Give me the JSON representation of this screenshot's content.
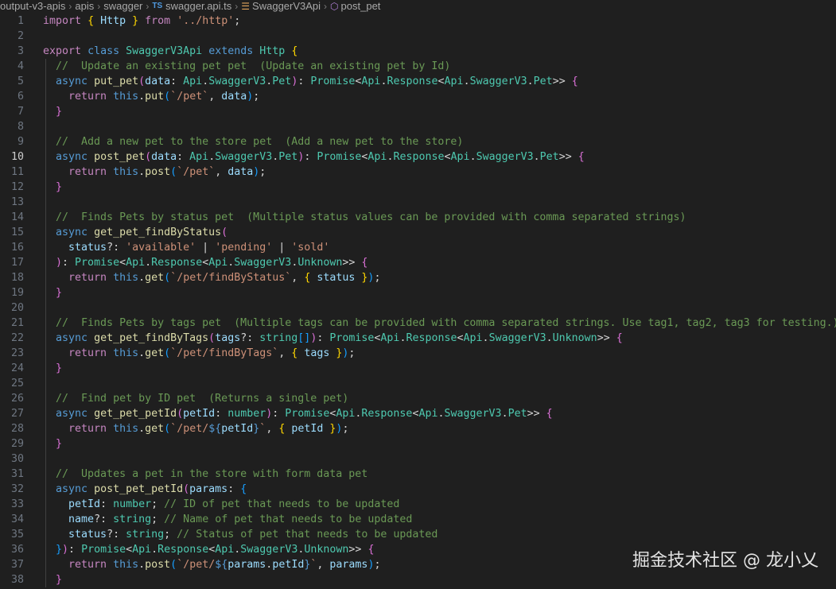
{
  "breadcrumb": {
    "segments": [
      "output-v3-apis",
      "apis",
      "swagger"
    ],
    "file_badge": "TS",
    "file": "swagger.api.ts",
    "class_name": "SwaggerV3Api",
    "method_name": "post_pet",
    "separator": "›"
  },
  "editor": {
    "active_line": 10,
    "colors": {
      "keyword": "#569cd6",
      "control": "#c586c0",
      "function": "#dcdcaa",
      "type": "#4ec9b0",
      "variable": "#9cdcfe",
      "string": "#ce9178",
      "comment": "#6a9955",
      "punctuation": "#d4d4d4",
      "brace_gold": "#ffd700",
      "brace_purple": "#da70d6",
      "brace_blue": "#179fff"
    },
    "lines": [
      [
        [
          "import",
          "control"
        ],
        [
          " ",
          "p"
        ],
        [
          "{",
          "brace_gold"
        ],
        [
          " Http ",
          "variable"
        ],
        [
          "}",
          "brace_gold"
        ],
        [
          " ",
          "p"
        ],
        [
          "from",
          "control"
        ],
        [
          " ",
          "p"
        ],
        [
          "'../http'",
          "string"
        ],
        [
          ";",
          "p"
        ]
      ],
      [],
      [
        [
          "export",
          "control"
        ],
        [
          " ",
          "p"
        ],
        [
          "class",
          "keyword"
        ],
        [
          " ",
          "p"
        ],
        [
          "SwaggerV3Api",
          "type"
        ],
        [
          " ",
          "p"
        ],
        [
          "extends",
          "keyword"
        ],
        [
          " ",
          "p"
        ],
        [
          "Http",
          "type"
        ],
        [
          " ",
          "p"
        ],
        [
          "{",
          "brace_gold"
        ]
      ],
      [
        [
          "  ",
          "p"
        ],
        [
          "//  Update an existing pet pet  (Update an existing pet by Id)",
          "comment"
        ]
      ],
      [
        [
          "  ",
          "p"
        ],
        [
          "async",
          "keyword"
        ],
        [
          " ",
          "p"
        ],
        [
          "put_pet",
          "function"
        ],
        [
          "(",
          "brace_purple"
        ],
        [
          "data",
          "variable"
        ],
        [
          ": ",
          "p"
        ],
        [
          "Api",
          "type"
        ],
        [
          ".",
          "p"
        ],
        [
          "SwaggerV3",
          "type"
        ],
        [
          ".",
          "p"
        ],
        [
          "Pet",
          "type"
        ],
        [
          ")",
          "brace_purple"
        ],
        [
          ": ",
          "p"
        ],
        [
          "Promise",
          "type"
        ],
        [
          "<",
          "p"
        ],
        [
          "Api",
          "type"
        ],
        [
          ".",
          "p"
        ],
        [
          "Response",
          "type"
        ],
        [
          "<",
          "p"
        ],
        [
          "Api",
          "type"
        ],
        [
          ".",
          "p"
        ],
        [
          "SwaggerV3",
          "type"
        ],
        [
          ".",
          "p"
        ],
        [
          "Pet",
          "type"
        ],
        [
          ">> ",
          "p"
        ],
        [
          "{",
          "brace_purple"
        ]
      ],
      [
        [
          "    ",
          "p"
        ],
        [
          "return",
          "control"
        ],
        [
          " ",
          "p"
        ],
        [
          "this",
          "keyword"
        ],
        [
          ".",
          "p"
        ],
        [
          "put",
          "function"
        ],
        [
          "(",
          "brace_blue"
        ],
        [
          "`/pet`",
          "string"
        ],
        [
          ", ",
          "p"
        ],
        [
          "data",
          "variable"
        ],
        [
          ")",
          "brace_blue"
        ],
        [
          ";",
          "p"
        ]
      ],
      [
        [
          "  ",
          "p"
        ],
        [
          "}",
          "brace_purple"
        ]
      ],
      [],
      [
        [
          "  ",
          "p"
        ],
        [
          "//  Add a new pet to the store pet  (Add a new pet to the store)",
          "comment"
        ]
      ],
      [
        [
          "  ",
          "p"
        ],
        [
          "async",
          "keyword"
        ],
        [
          " ",
          "p"
        ],
        [
          "post_pet",
          "function"
        ],
        [
          "(",
          "brace_purple"
        ],
        [
          "data",
          "variable"
        ],
        [
          ": ",
          "p"
        ],
        [
          "Api",
          "type"
        ],
        [
          ".",
          "p"
        ],
        [
          "SwaggerV3",
          "type"
        ],
        [
          ".",
          "p"
        ],
        [
          "Pet",
          "type"
        ],
        [
          ")",
          "brace_purple"
        ],
        [
          ": ",
          "p"
        ],
        [
          "Promise",
          "type"
        ],
        [
          "<",
          "p"
        ],
        [
          "Api",
          "type"
        ],
        [
          ".",
          "p"
        ],
        [
          "Response",
          "type"
        ],
        [
          "<",
          "p"
        ],
        [
          "Api",
          "type"
        ],
        [
          ".",
          "p"
        ],
        [
          "SwaggerV3",
          "type"
        ],
        [
          ".",
          "p"
        ],
        [
          "Pet",
          "type"
        ],
        [
          ">> ",
          "p"
        ],
        [
          "{",
          "brace_purple"
        ]
      ],
      [
        [
          "    ",
          "p"
        ],
        [
          "return",
          "control"
        ],
        [
          " ",
          "p"
        ],
        [
          "this",
          "keyword"
        ],
        [
          ".",
          "p"
        ],
        [
          "post",
          "function"
        ],
        [
          "(",
          "brace_blue"
        ],
        [
          "`/pet`",
          "string"
        ],
        [
          ", ",
          "p"
        ],
        [
          "data",
          "variable"
        ],
        [
          ")",
          "brace_blue"
        ],
        [
          ";",
          "p"
        ]
      ],
      [
        [
          "  ",
          "p"
        ],
        [
          "}",
          "brace_purple"
        ]
      ],
      [],
      [
        [
          "  ",
          "p"
        ],
        [
          "//  Finds Pets by status pet  (Multiple status values can be provided with comma separated strings)",
          "comment"
        ]
      ],
      [
        [
          "  ",
          "p"
        ],
        [
          "async",
          "keyword"
        ],
        [
          " ",
          "p"
        ],
        [
          "get_pet_findByStatus",
          "function"
        ],
        [
          "(",
          "brace_purple"
        ]
      ],
      [
        [
          "    ",
          "p"
        ],
        [
          "status",
          "variable"
        ],
        [
          "?: ",
          "p"
        ],
        [
          "'available'",
          "string"
        ],
        [
          " | ",
          "p"
        ],
        [
          "'pending'",
          "string"
        ],
        [
          " | ",
          "p"
        ],
        [
          "'sold'",
          "string"
        ]
      ],
      [
        [
          "  ",
          "p"
        ],
        [
          ")",
          "brace_purple"
        ],
        [
          ": ",
          "p"
        ],
        [
          "Promise",
          "type"
        ],
        [
          "<",
          "p"
        ],
        [
          "Api",
          "type"
        ],
        [
          ".",
          "p"
        ],
        [
          "Response",
          "type"
        ],
        [
          "<",
          "p"
        ],
        [
          "Api",
          "type"
        ],
        [
          ".",
          "p"
        ],
        [
          "SwaggerV3",
          "type"
        ],
        [
          ".",
          "p"
        ],
        [
          "Unknown",
          "type"
        ],
        [
          ">> ",
          "p"
        ],
        [
          "{",
          "brace_purple"
        ]
      ],
      [
        [
          "    ",
          "p"
        ],
        [
          "return",
          "control"
        ],
        [
          " ",
          "p"
        ],
        [
          "this",
          "keyword"
        ],
        [
          ".",
          "p"
        ],
        [
          "get",
          "function"
        ],
        [
          "(",
          "brace_blue"
        ],
        [
          "`/pet/findByStatus`",
          "string"
        ],
        [
          ", ",
          "p"
        ],
        [
          "{",
          "brace_gold"
        ],
        [
          " ",
          "p"
        ],
        [
          "status",
          "variable"
        ],
        [
          " ",
          "p"
        ],
        [
          "}",
          "brace_gold"
        ],
        [
          ")",
          "brace_blue"
        ],
        [
          ";",
          "p"
        ]
      ],
      [
        [
          "  ",
          "p"
        ],
        [
          "}",
          "brace_purple"
        ]
      ],
      [],
      [
        [
          "  ",
          "p"
        ],
        [
          "//  Finds Pets by tags pet  (Multiple tags can be provided with comma separated strings. Use tag1, tag2, tag3 for testing.)",
          "comment"
        ]
      ],
      [
        [
          "  ",
          "p"
        ],
        [
          "async",
          "keyword"
        ],
        [
          " ",
          "p"
        ],
        [
          "get_pet_findByTags",
          "function"
        ],
        [
          "(",
          "brace_purple"
        ],
        [
          "tags",
          "variable"
        ],
        [
          "?: ",
          "p"
        ],
        [
          "string",
          "type"
        ],
        [
          "[]",
          "brace_blue"
        ],
        [
          ")",
          "brace_purple"
        ],
        [
          ": ",
          "p"
        ],
        [
          "Promise",
          "type"
        ],
        [
          "<",
          "p"
        ],
        [
          "Api",
          "type"
        ],
        [
          ".",
          "p"
        ],
        [
          "Response",
          "type"
        ],
        [
          "<",
          "p"
        ],
        [
          "Api",
          "type"
        ],
        [
          ".",
          "p"
        ],
        [
          "SwaggerV3",
          "type"
        ],
        [
          ".",
          "p"
        ],
        [
          "Unknown",
          "type"
        ],
        [
          ">> ",
          "p"
        ],
        [
          "{",
          "brace_purple"
        ]
      ],
      [
        [
          "    ",
          "p"
        ],
        [
          "return",
          "control"
        ],
        [
          " ",
          "p"
        ],
        [
          "this",
          "keyword"
        ],
        [
          ".",
          "p"
        ],
        [
          "get",
          "function"
        ],
        [
          "(",
          "brace_blue"
        ],
        [
          "`/pet/findByTags`",
          "string"
        ],
        [
          ", ",
          "p"
        ],
        [
          "{",
          "brace_gold"
        ],
        [
          " ",
          "p"
        ],
        [
          "tags",
          "variable"
        ],
        [
          " ",
          "p"
        ],
        [
          "}",
          "brace_gold"
        ],
        [
          ")",
          "brace_blue"
        ],
        [
          ";",
          "p"
        ]
      ],
      [
        [
          "  ",
          "p"
        ],
        [
          "}",
          "brace_purple"
        ]
      ],
      [],
      [
        [
          "  ",
          "p"
        ],
        [
          "//  Find pet by ID pet  (Returns a single pet)",
          "comment"
        ]
      ],
      [
        [
          "  ",
          "p"
        ],
        [
          "async",
          "keyword"
        ],
        [
          " ",
          "p"
        ],
        [
          "get_pet_petId",
          "function"
        ],
        [
          "(",
          "brace_purple"
        ],
        [
          "petId",
          "variable"
        ],
        [
          ": ",
          "p"
        ],
        [
          "number",
          "type"
        ],
        [
          ")",
          "brace_purple"
        ],
        [
          ": ",
          "p"
        ],
        [
          "Promise",
          "type"
        ],
        [
          "<",
          "p"
        ],
        [
          "Api",
          "type"
        ],
        [
          ".",
          "p"
        ],
        [
          "Response",
          "type"
        ],
        [
          "<",
          "p"
        ],
        [
          "Api",
          "type"
        ],
        [
          ".",
          "p"
        ],
        [
          "SwaggerV3",
          "type"
        ],
        [
          ".",
          "p"
        ],
        [
          "Pet",
          "type"
        ],
        [
          ">> ",
          "p"
        ],
        [
          "{",
          "brace_purple"
        ]
      ],
      [
        [
          "    ",
          "p"
        ],
        [
          "return",
          "control"
        ],
        [
          " ",
          "p"
        ],
        [
          "this",
          "keyword"
        ],
        [
          ".",
          "p"
        ],
        [
          "get",
          "function"
        ],
        [
          "(",
          "brace_blue"
        ],
        [
          "`/pet/",
          "string"
        ],
        [
          "${",
          "keyword"
        ],
        [
          "petId",
          "variable"
        ],
        [
          "}",
          "keyword"
        ],
        [
          "`",
          "string"
        ],
        [
          ", ",
          "p"
        ],
        [
          "{",
          "brace_gold"
        ],
        [
          " ",
          "p"
        ],
        [
          "petId",
          "variable"
        ],
        [
          " ",
          "p"
        ],
        [
          "}",
          "brace_gold"
        ],
        [
          ")",
          "brace_blue"
        ],
        [
          ";",
          "p"
        ]
      ],
      [
        [
          "  ",
          "p"
        ],
        [
          "}",
          "brace_purple"
        ]
      ],
      [],
      [
        [
          "  ",
          "p"
        ],
        [
          "//  Updates a pet in the store with form data pet",
          "comment"
        ]
      ],
      [
        [
          "  ",
          "p"
        ],
        [
          "async",
          "keyword"
        ],
        [
          " ",
          "p"
        ],
        [
          "post_pet_petId",
          "function"
        ],
        [
          "(",
          "brace_purple"
        ],
        [
          "params",
          "variable"
        ],
        [
          ": ",
          "p"
        ],
        [
          "{",
          "brace_blue"
        ]
      ],
      [
        [
          "    ",
          "p"
        ],
        [
          "petId",
          "variable"
        ],
        [
          ": ",
          "p"
        ],
        [
          "number",
          "type"
        ],
        [
          "; ",
          "p"
        ],
        [
          "// ID of pet that needs to be updated",
          "comment"
        ]
      ],
      [
        [
          "    ",
          "p"
        ],
        [
          "name",
          "variable"
        ],
        [
          "?: ",
          "p"
        ],
        [
          "string",
          "type"
        ],
        [
          "; ",
          "p"
        ],
        [
          "// Name of pet that needs to be updated",
          "comment"
        ]
      ],
      [
        [
          "    ",
          "p"
        ],
        [
          "status",
          "variable"
        ],
        [
          "?: ",
          "p"
        ],
        [
          "string",
          "type"
        ],
        [
          "; ",
          "p"
        ],
        [
          "// Status of pet that needs to be updated",
          "comment"
        ]
      ],
      [
        [
          "  ",
          "p"
        ],
        [
          "}",
          "brace_blue"
        ],
        [
          ")",
          "brace_purple"
        ],
        [
          ": ",
          "p"
        ],
        [
          "Promise",
          "type"
        ],
        [
          "<",
          "p"
        ],
        [
          "Api",
          "type"
        ],
        [
          ".",
          "p"
        ],
        [
          "Response",
          "type"
        ],
        [
          "<",
          "p"
        ],
        [
          "Api",
          "type"
        ],
        [
          ".",
          "p"
        ],
        [
          "SwaggerV3",
          "type"
        ],
        [
          ".",
          "p"
        ],
        [
          "Unknown",
          "type"
        ],
        [
          ">> ",
          "p"
        ],
        [
          "{",
          "brace_purple"
        ]
      ],
      [
        [
          "    ",
          "p"
        ],
        [
          "return",
          "control"
        ],
        [
          " ",
          "p"
        ],
        [
          "this",
          "keyword"
        ],
        [
          ".",
          "p"
        ],
        [
          "post",
          "function"
        ],
        [
          "(",
          "brace_blue"
        ],
        [
          "`/pet/",
          "string"
        ],
        [
          "${",
          "keyword"
        ],
        [
          "params",
          "variable"
        ],
        [
          ".",
          "p"
        ],
        [
          "petId",
          "variable"
        ],
        [
          "}",
          "keyword"
        ],
        [
          "`",
          "string"
        ],
        [
          ", ",
          "p"
        ],
        [
          "params",
          "variable"
        ],
        [
          ")",
          "brace_blue"
        ],
        [
          ";",
          "p"
        ]
      ],
      [
        [
          "  ",
          "p"
        ],
        [
          "}",
          "brace_purple"
        ]
      ]
    ]
  },
  "watermark": "掘金技术社区 @ 龙小乂"
}
